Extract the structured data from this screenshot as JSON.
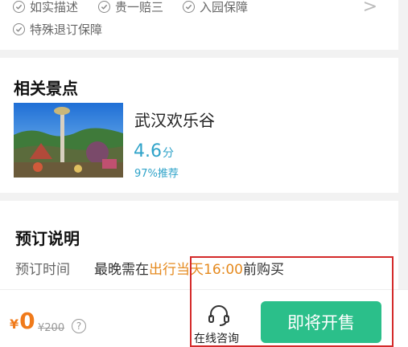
{
  "guarantees": {
    "items": [
      "如实描述",
      "贵一赔三",
      "入园保障",
      "特殊退订保障"
    ],
    "chevron": ">"
  },
  "attraction": {
    "section_title": "相关景点",
    "name": "武汉欢乐谷",
    "rating": "4.6",
    "rating_unit": "分",
    "recommend": "97%推荐"
  },
  "booking": {
    "section_title": "预订说明",
    "time_label": "预订时间",
    "time_prefix": "最晚需在",
    "time_highlight": "出行当天16:00",
    "time_suffix": "前购买"
  },
  "bottom": {
    "currency": "¥",
    "price": "0",
    "original_price": "¥200",
    "help": "?",
    "consult_label": "在线咨询",
    "buy_label": "即将开售"
  },
  "colors": {
    "accent_orange": "#e58a1f",
    "price_orange": "#f07a1a",
    "rating_blue": "#2fa3c9",
    "buy_green": "#2bbf8a",
    "annotation_red": "#d42a2a"
  }
}
